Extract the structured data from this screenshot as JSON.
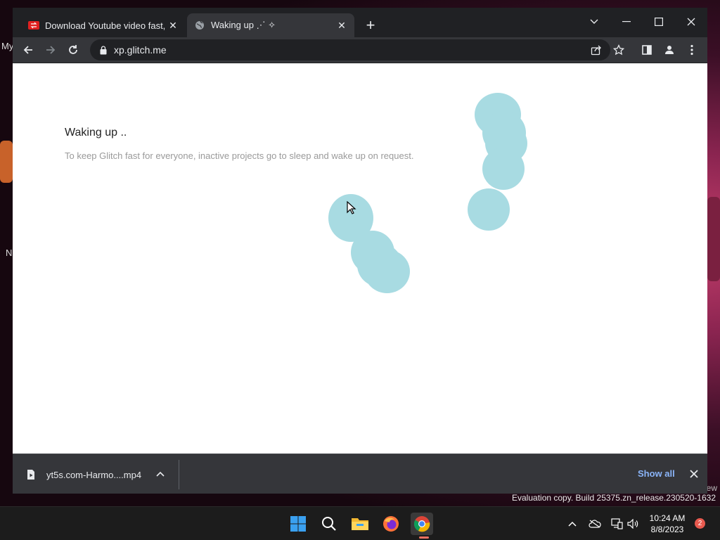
{
  "desktop": {
    "edge_text_top": "My",
    "edge_text_mid": "N",
    "edge_text_right": "ew"
  },
  "browser": {
    "tabs": [
      {
        "title": "Download Youtube video fast, co",
        "active": false
      },
      {
        "title": "Waking up ⋰ ✧",
        "active": true
      }
    ],
    "url": "xp.glitch.me"
  },
  "page": {
    "heading": "Waking up ..",
    "description": "To keep Glitch fast for everyone, inactive projects go to sleep and wake up on request.",
    "blob_color": "#a8dbe2"
  },
  "download_bar": {
    "filename": "yt5s.com-Harmo....mp4",
    "show_all_label": "Show all"
  },
  "watermark": {
    "text": "Evaluation copy. Build 25375.zn_release.230520-1632"
  },
  "taskbar": {
    "clock_time": "10:24 AM",
    "clock_date": "8/8/2023",
    "notification_count": "2"
  },
  "colors": {
    "tab_bar": "#202124",
    "toolbar": "#35363a",
    "link_blue": "#8ab4f8",
    "taskbar": "#1c1c1c"
  }
}
